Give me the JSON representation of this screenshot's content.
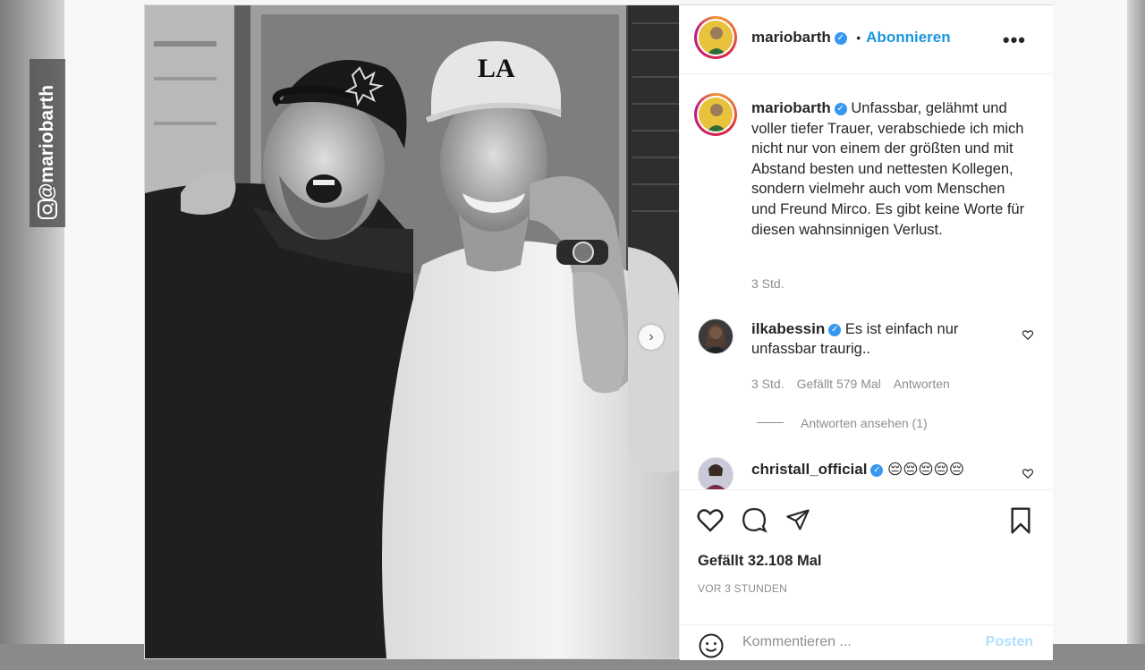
{
  "watermark": {
    "handle": "@mariobarth",
    "icon": "instagram-icon"
  },
  "post": {
    "author": "mariobarth",
    "follow_separator": "•",
    "follow_label": "Abonnieren",
    "more_label": "•••",
    "caption": "Unfassbar, gelähmt und voller tiefer Trauer, verabschiede ich mich nicht nur von einem der größten und mit Abstand besten und nettesten Kollegen, sondern vielmehr auch vom Menschen und Freund Mirco. Es gibt keine Worte für diesen wahnsinnigen Verlust.",
    "caption_time": "3 Std.",
    "carousel_next": "›",
    "photo_cap_logo": "LA"
  },
  "comments": [
    {
      "user": "ilkabessin",
      "text": "Es ist einfach nur unfassbar traurig..",
      "time": "3 Std.",
      "likes": "Gefällt 579 Mal",
      "reply": "Antworten",
      "view_replies": "Antworten ansehen (1)"
    },
    {
      "user": "christall_official",
      "text": "😔😔😔😔😔"
    }
  ],
  "footer": {
    "likes": "Gefällt 32.108 Mal",
    "ago": "VOR 3 STUNDEN",
    "comment_placeholder": "Kommentieren ...",
    "post_label": "Posten"
  },
  "colors": {
    "accent": "#1b95e0",
    "verified": "#3897f0",
    "text": "#262626",
    "muted": "#8e8e8e"
  }
}
